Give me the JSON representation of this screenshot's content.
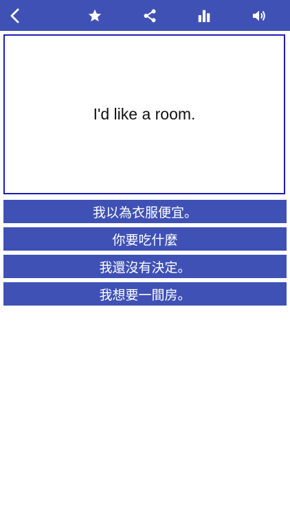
{
  "colors": {
    "accent": "#3f51b5",
    "accent_border": "#1a1ab8",
    "background": "#ffffff"
  },
  "toolbar": {
    "icons": [
      "back-icon",
      "star-icon",
      "share-icon",
      "stats-icon",
      "speaker-icon"
    ]
  },
  "card": {
    "text": "I'd like a room."
  },
  "options": [
    {
      "label": "我以為衣服便宜。"
    },
    {
      "label": "你要吃什麼"
    },
    {
      "label": "我還沒有決定。"
    },
    {
      "label": "我想要一間房。"
    }
  ]
}
